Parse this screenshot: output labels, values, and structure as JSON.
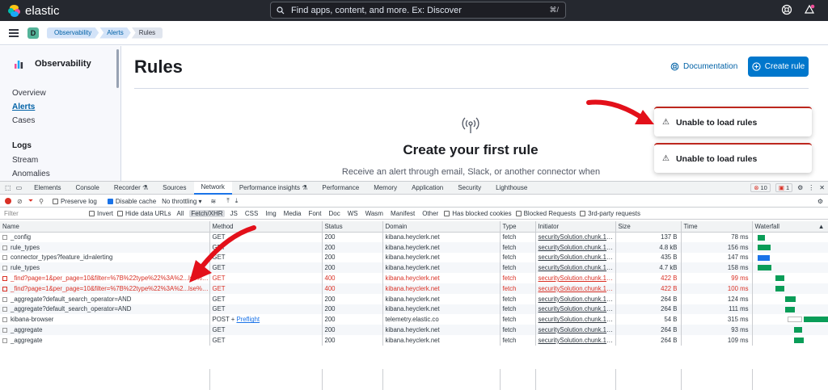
{
  "header": {
    "brand": "elastic",
    "search_placeholder": "Find apps, content, and more. Ex: Discover",
    "search_shortcut": "⌘/"
  },
  "breadcrumbs": {
    "space": "D",
    "items": [
      "Observability",
      "Alerts",
      "Rules"
    ]
  },
  "sidebar": {
    "title": "Observability",
    "items": [
      "Overview",
      "Alerts",
      "Cases"
    ],
    "logs_heading": "Logs",
    "logs_items": [
      "Stream",
      "Anomalies"
    ]
  },
  "main": {
    "title": "Rules",
    "documentation": "Documentation",
    "create_rule": "Create rule",
    "empty_title": "Create your first rule",
    "empty_desc": "Receive an alert through email, Slack, or another connector when"
  },
  "toasts": [
    "Unable to load rules",
    "Unable to load rules"
  ],
  "devtools": {
    "tabs": [
      "Elements",
      "Console",
      "Recorder ⚗",
      "Sources",
      "Network",
      "Performance insights ⚗",
      "Performance",
      "Memory",
      "Application",
      "Security",
      "Lighthouse"
    ],
    "active_tab": "Network",
    "errors": "10",
    "issues": "1",
    "toolbar": {
      "preserve_log": "Preserve log",
      "disable_cache": "Disable cache",
      "throttling": "No throttling"
    },
    "filter_bar": {
      "filter_placeholder": "Filter",
      "invert": "Invert",
      "hide_data_urls": "Hide data URLs",
      "types": [
        "All",
        "Fetch/XHR",
        "JS",
        "CSS",
        "Img",
        "Media",
        "Font",
        "Doc",
        "WS",
        "Wasm",
        "Manifest",
        "Other"
      ],
      "selected_type": "Fetch/XHR",
      "blocked_cookies": "Has blocked cookies",
      "blocked_requests": "Blocked Requests",
      "third_party": "3rd-party requests"
    },
    "columns": [
      "Name",
      "Method",
      "Status",
      "Domain",
      "Type",
      "Initiator",
      "Size",
      "Time",
      "Waterfall"
    ],
    "rows": [
      {
        "name": "_config",
        "method": "GET",
        "status": "200",
        "domain": "kibana.heyclerk.net",
        "type": "fetch",
        "initiator": "securitySolution.chunk.17...",
        "size": "137 B",
        "time": "78 ms",
        "wf_start": 0.02,
        "wf_len": 0.1,
        "wf_color": "#0a9d58",
        "error": false
      },
      {
        "name": "rule_types",
        "method": "GET",
        "status": "200",
        "domain": "kibana.heyclerk.net",
        "type": "fetch",
        "initiator": "securitySolution.chunk.17...",
        "size": "4.8 kB",
        "time": "156 ms",
        "wf_start": 0.02,
        "wf_len": 0.18,
        "wf_color": "#0a9d58",
        "error": false
      },
      {
        "name": "connector_types?feature_id=alerting",
        "method": "GET",
        "status": "200",
        "domain": "kibana.heyclerk.net",
        "type": "fetch",
        "initiator": "securitySolution.chunk.17...",
        "size": "435 B",
        "time": "147 ms",
        "wf_start": 0.02,
        "wf_len": 0.17,
        "wf_color": "#1a73e8",
        "error": false
      },
      {
        "name": "rule_types",
        "method": "GET",
        "status": "200",
        "domain": "kibana.heyclerk.net",
        "type": "fetch",
        "initiator": "securitySolution.chunk.17...",
        "size": "4.7 kB",
        "time": "158 ms",
        "wf_start": 0.02,
        "wf_len": 0.19,
        "wf_color": "#0a9d58",
        "error": false
      },
      {
        "name": "_find?page=1&per_page=10&filter=%7B%22type%22%3A%2...lse%7...",
        "method": "GET",
        "status": "400",
        "domain": "kibana.heyclerk.net",
        "type": "fetch",
        "initiator": "securitySolution.chunk.17...",
        "size": "422 B",
        "time": "99 ms",
        "wf_start": 0.27,
        "wf_len": 0.12,
        "wf_color": "#0a9d58",
        "error": true
      },
      {
        "name": "_find?page=1&per_page=10&filter=%7B%22type%22%3A%2...lse%7...",
        "method": "GET",
        "status": "400",
        "domain": "kibana.heyclerk.net",
        "type": "fetch",
        "initiator": "securitySolution.chunk.17...",
        "size": "422 B",
        "time": "100 ms",
        "wf_start": 0.27,
        "wf_len": 0.12,
        "wf_color": "#0a9d58",
        "error": true
      },
      {
        "name": "_aggregate?default_search_operator=AND",
        "method": "GET",
        "status": "200",
        "domain": "kibana.heyclerk.net",
        "type": "fetch",
        "initiator": "securitySolution.chunk.17...",
        "size": "264 B",
        "time": "124 ms",
        "wf_start": 0.4,
        "wf_len": 0.14,
        "wf_color": "#0a9d58",
        "error": false
      },
      {
        "name": "_aggregate?default_search_operator=AND",
        "method": "GET",
        "status": "200",
        "domain": "kibana.heyclerk.net",
        "type": "fetch",
        "initiator": "securitySolution.chunk.17...",
        "size": "264 B",
        "time": "111 ms",
        "wf_start": 0.4,
        "wf_len": 0.13,
        "wf_color": "#0a9d58",
        "error": false
      },
      {
        "name": "kibana-browser",
        "method": "POST + ",
        "method_link": "Preflight",
        "status": "200",
        "domain": "telemetry.elastic.co",
        "type": "fetch",
        "initiator": "securitySolution.chunk.17...",
        "size": "54 B",
        "time": "315 ms",
        "wf_start": 0.66,
        "wf_len": 0.34,
        "wf_color": "#0a9d58",
        "error": false
      },
      {
        "name": "_aggregate",
        "method": "GET",
        "status": "200",
        "domain": "kibana.heyclerk.net",
        "type": "fetch",
        "initiator": "securitySolution.chunk.17...",
        "size": "264 B",
        "time": "93 ms",
        "wf_start": 0.52,
        "wf_len": 0.11,
        "wf_color": "#0a9d58",
        "error": false
      },
      {
        "name": "_aggregate",
        "method": "GET",
        "status": "200",
        "domain": "kibana.heyclerk.net",
        "type": "fetch",
        "initiator": "securitySolution.chunk.17...",
        "size": "264 B",
        "time": "109 ms",
        "wf_start": 0.52,
        "wf_len": 0.13,
        "wf_color": "#0a9d58",
        "error": false
      }
    ]
  },
  "colors": {
    "header_bg": "#25282f",
    "primary": "#0077cc",
    "danger": "#bd271e",
    "devtools_error": "#d93025",
    "annotation_arrow": "#e3101a"
  }
}
